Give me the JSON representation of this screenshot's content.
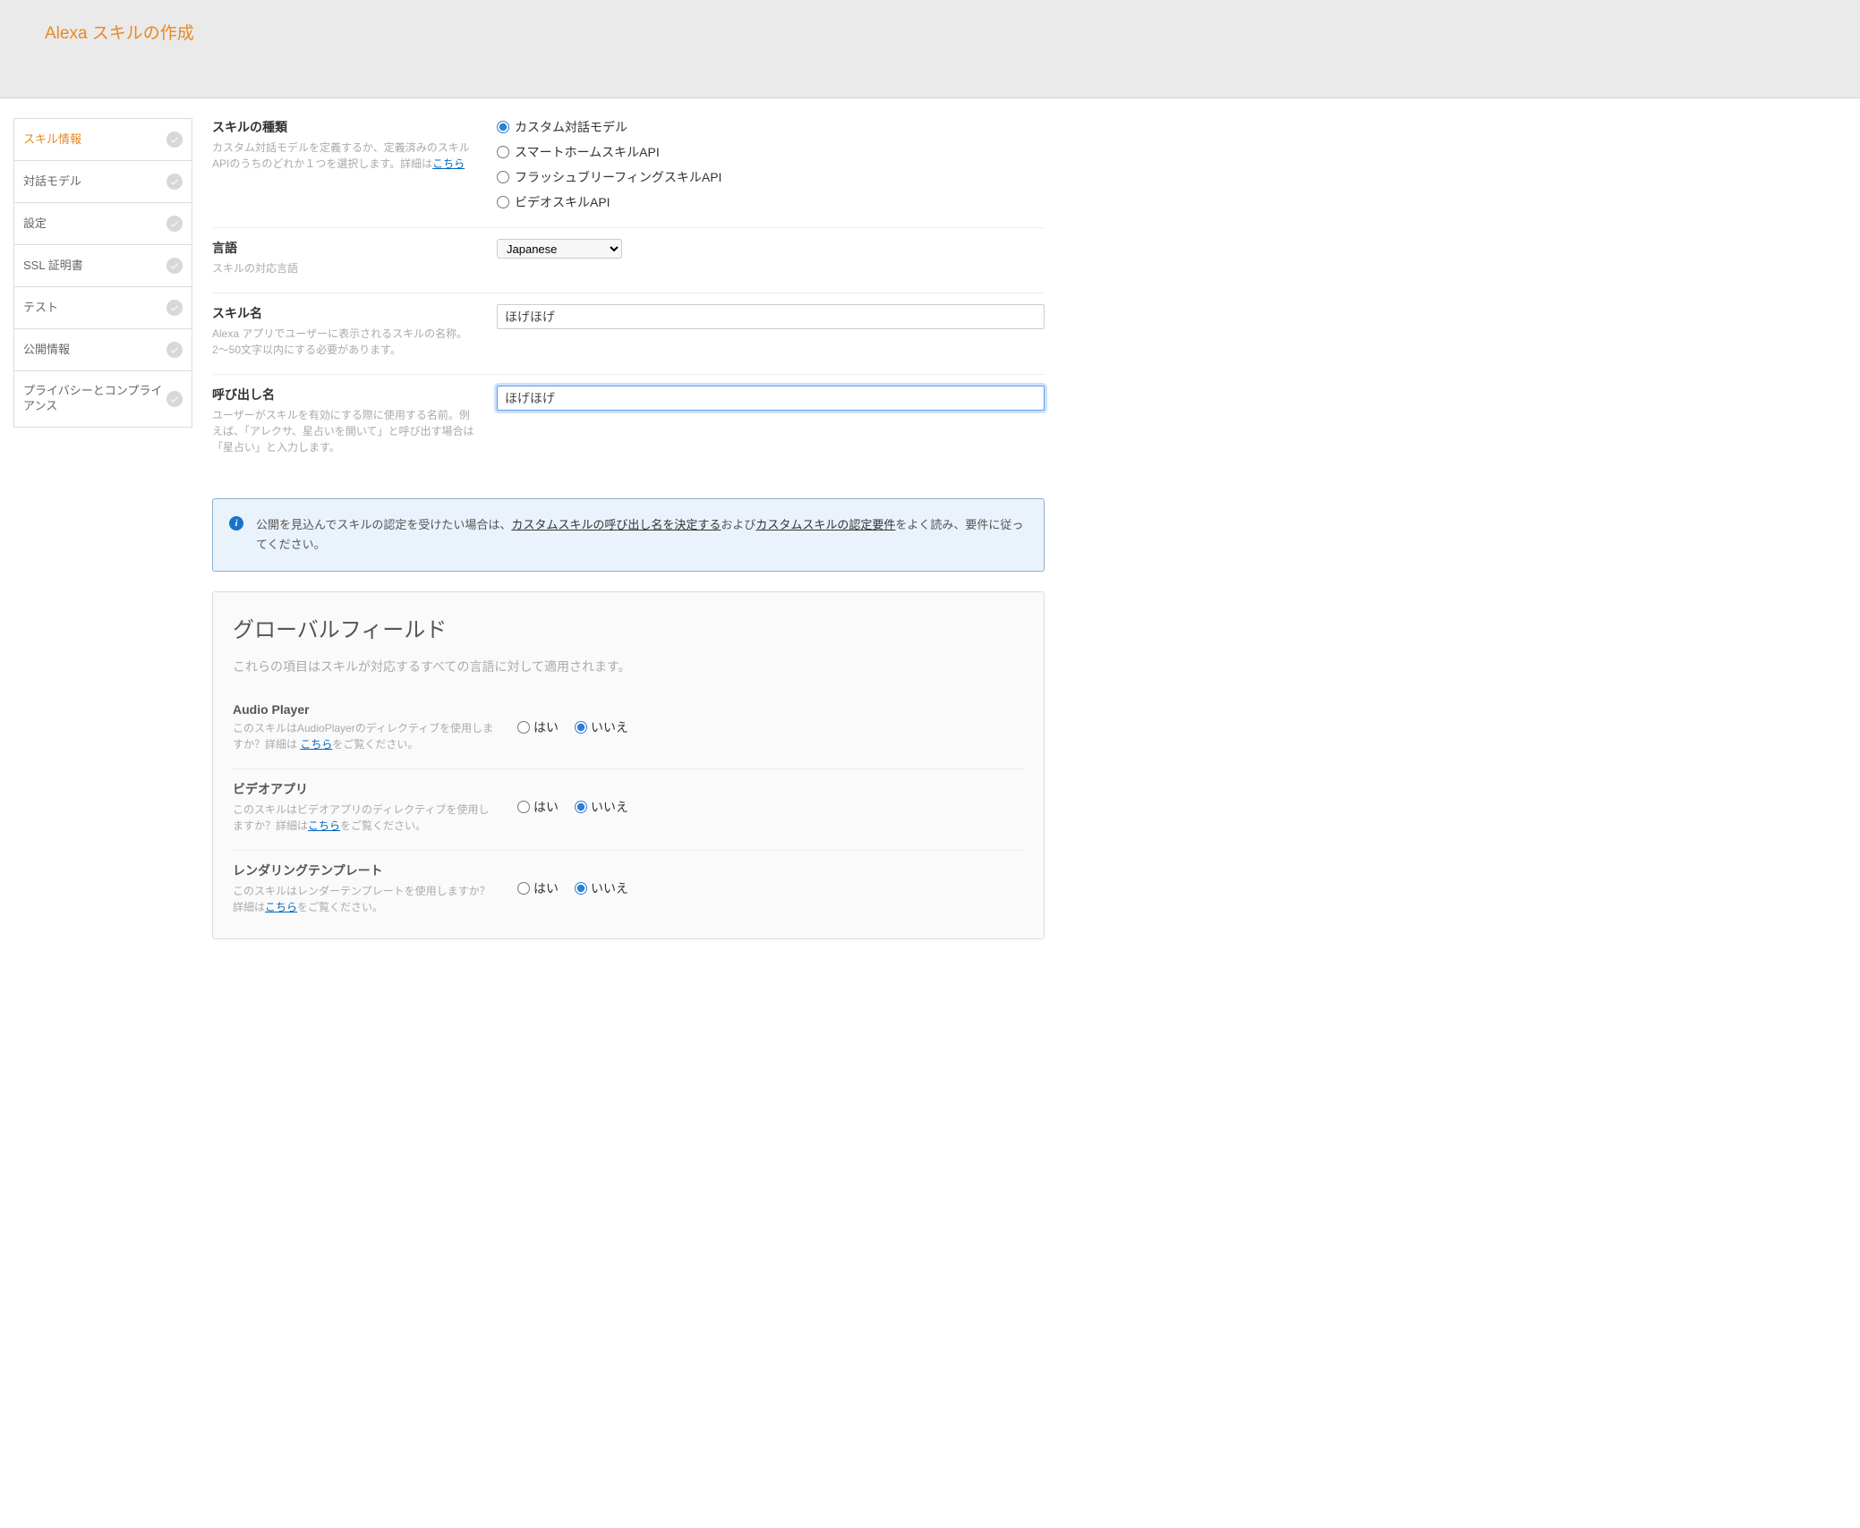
{
  "header": {
    "title": "Alexa スキルの作成"
  },
  "sidebar": {
    "items": [
      {
        "label": "スキル情報",
        "active": true
      },
      {
        "label": "対話モデル"
      },
      {
        "label": "設定"
      },
      {
        "label": "SSL 証明書"
      },
      {
        "label": "テスト"
      },
      {
        "label": "公開情報"
      },
      {
        "label": "プライバシーとコンプライアンス"
      }
    ]
  },
  "form": {
    "skill_type": {
      "title": "スキルの種類",
      "desc_pre": "カスタム対話モデルを定義するか、定義済みのスキルAPIのうちのどれか１つを選択します。詳細は",
      "desc_link": "こちら",
      "options": [
        "カスタム対話モデル",
        "スマートホームスキルAPI",
        "フラッシュブリーフィングスキルAPI",
        "ビデオスキルAPI"
      ],
      "selected": 0
    },
    "language": {
      "title": "言語",
      "desc": "スキルの対応言語",
      "value": "Japanese"
    },
    "skill_name": {
      "title": "スキル名",
      "desc": "Alexa アプリでユーザーに表示されるスキルの名称。2〜50文字以内にする必要があります。",
      "value": "ほげほげ"
    },
    "invocation_name": {
      "title": "呼び出し名",
      "desc": "ユーザーがスキルを有効にする際に使用する名前。例えば、「アレクサ、星占いを開いて」と呼び出す場合は「星占い」と入力します。",
      "value": "ほげほげ"
    }
  },
  "info_callout": {
    "text_pre": "公開を見込んでスキルの認定を受けたい場合は、",
    "link1": "カスタムスキルの呼び出し名を決定する",
    "mid": "および",
    "link2": "カスタムスキルの認定要件",
    "text_post": "をよく読み、要件に従ってください。"
  },
  "global": {
    "title": "グローバルフィールド",
    "sub": "これらの項目はスキルが対応するすべての言語に対して適用されます。",
    "yes": "はい",
    "no": "いいえ",
    "audio_player": {
      "title": "Audio Player",
      "desc_pre": "このスキルはAudioPlayerのディレクティブを使用しますか？詳細は ",
      "link": "こちら",
      "desc_post": "をご覧ください。",
      "selected": "no"
    },
    "video_app": {
      "title": "ビデオアプリ",
      "desc_pre": "このスキルはビデオアプリのディレクティブを使用しますか？詳細は",
      "link": "こちら",
      "desc_post": "をご覧ください。",
      "selected": "no"
    },
    "render_template": {
      "title": "レンダリングテンプレート",
      "desc_pre": "このスキルはレンダーテンプレートを使用しますか？詳細は",
      "link": "こちら",
      "desc_post": "をご覧ください。",
      "selected": "no"
    }
  }
}
